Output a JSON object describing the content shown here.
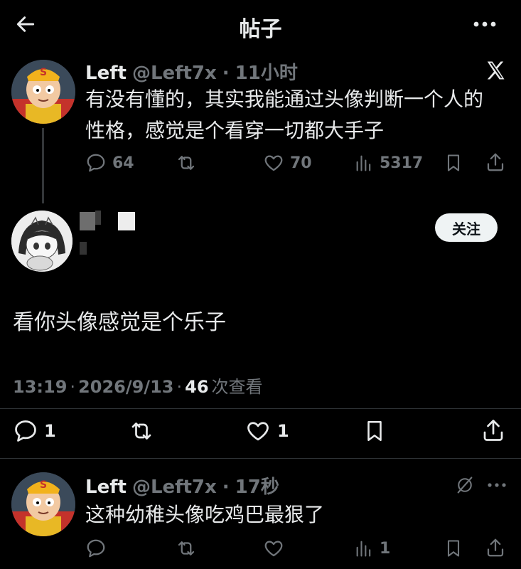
{
  "header": {
    "title": "帖子"
  },
  "original_post": {
    "author_name": "Left",
    "handle": "@Left7x",
    "separator": "·",
    "time": "11小时",
    "text_line1": "有没有懂的，其实我能通过头像判断一个人的",
    "text_line2": "性格，感觉是个看穿一切都大手子",
    "stats": {
      "replies": "64",
      "likes": "70",
      "views": "5317"
    }
  },
  "reply_post": {
    "follow_label": "关注",
    "text": "看你头像感觉是个乐子",
    "time": "13:19",
    "date": "2026/9/13",
    "views": "46",
    "views_label": "次查看",
    "sep1": "·",
    "sep2": "·",
    "stats": {
      "replies": "1",
      "likes": "1"
    }
  },
  "second_reply": {
    "author_name": "Left",
    "handle": "@Left7x",
    "separator": "·",
    "time": "17秒",
    "text": "这种幼稚头像吃鸡巴最狠了",
    "stats": {
      "views": "1"
    }
  },
  "colors": {
    "background": "#000000",
    "text": "#e7e9ea",
    "muted": "#71767b",
    "divider": "#2f3336"
  }
}
